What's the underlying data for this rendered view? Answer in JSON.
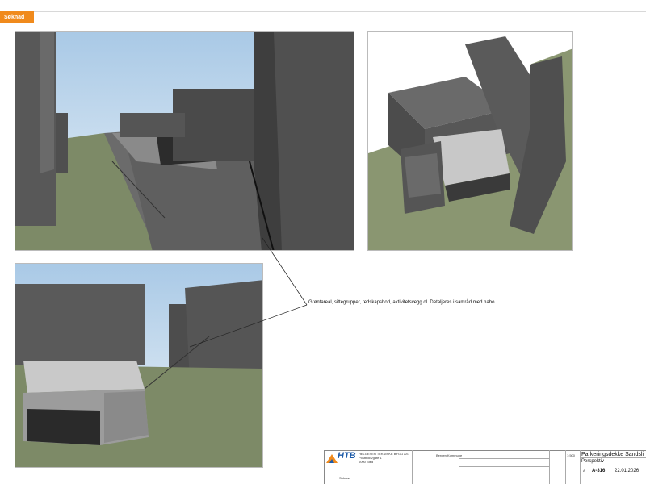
{
  "status_tag": "Søknad",
  "callout_text": "Grøntareal, sittegrupper, redskapsbod, aktivitetsvegg ol. Detaljeres i samråd med nabo.",
  "title_block": {
    "company_name": "HELGESEN TEKNISKE BYGG AS",
    "company_addr1": "Postboks/gate 1",
    "company_addr2": "0000 Sted",
    "logo_text": "HTB",
    "status_label": "Søknad",
    "client_label": "Bergen Kommune",
    "project_title": "Parkeringsdekke Sandsli",
    "sheet_title": "Perspektiv",
    "scale": "1:500",
    "drawing_number": "A-316",
    "date": "22.01.2026",
    "rev_label": "A"
  },
  "colors": {
    "status_tag": "#f08a1c",
    "logo_blue": "#1c5aa8",
    "building": "#5a5a5a",
    "grass": "#7f8c6a",
    "sky": "#b8d4ea"
  }
}
